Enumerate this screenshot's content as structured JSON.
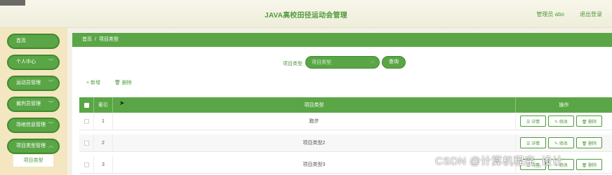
{
  "header": {
    "title": "JAVA高校田径运动会管理",
    "user": "管理员 abo",
    "logout": "退出登录"
  },
  "sidebar": {
    "items": [
      {
        "label": "首页",
        "chevron": false
      },
      {
        "label": "个人中心",
        "chevron": true
      },
      {
        "label": "运动员管理",
        "chevron": true
      },
      {
        "label": "裁判员管理",
        "chevron": true
      },
      {
        "label": "场地信息管理",
        "chevron": true
      },
      {
        "label": "项目类型管理",
        "chevron": true
      }
    ],
    "submenu_item": "项目类型"
  },
  "breadcrumb": {
    "home": "首页",
    "separator": "/",
    "current": "项目类型"
  },
  "search": {
    "label": "项目类型",
    "placeholder": "项目类型",
    "button": "查询"
  },
  "toolbar": {
    "add": "+ 新增",
    "delete": "🗑 删除"
  },
  "table": {
    "headers": {
      "index": "索引",
      "type": "项目类型",
      "ops": "操作"
    },
    "rows": [
      {
        "index": "1",
        "type": "跑步"
      },
      {
        "index": "2",
        "type": "项目类型2"
      },
      {
        "index": "3",
        "type": "项目类型3"
      }
    ],
    "ops": {
      "detail": "☰ 详情",
      "edit": "✎ 修改",
      "delete": "🗑 删除"
    }
  },
  "watermark": "CSDN @计算机程序_设计",
  "colors": {
    "accent": "#5aa646",
    "accent_dark": "#3f8a2e",
    "sidebar_bg": "#f3e6c1",
    "page_bg": "#f3f1e6"
  }
}
